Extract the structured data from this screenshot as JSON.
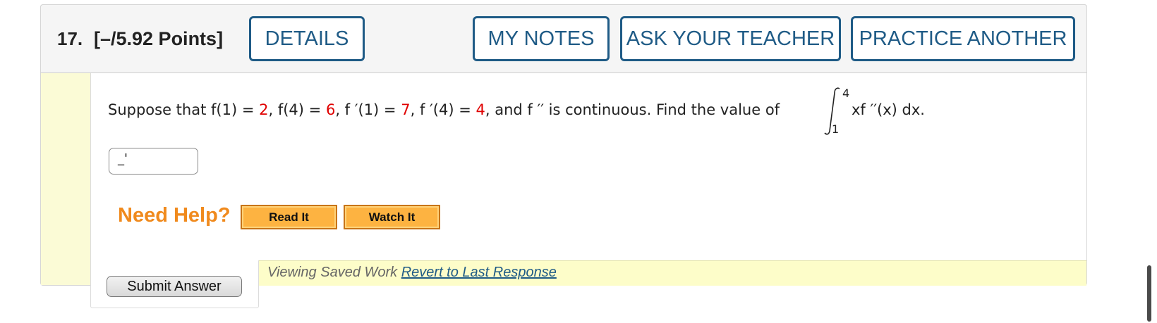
{
  "header": {
    "question_number": "17.",
    "points": "[–/5.92 Points]",
    "details_label": "DETAILS",
    "my_notes_label": "MY NOTES",
    "ask_teacher_label": "ASK YOUR TEACHER",
    "practice_another_label": "PRACTICE ANOTHER"
  },
  "question": {
    "intro": "Suppose that ",
    "f1_lhs": "f(1) = ",
    "f1_val": "2",
    "f4_lhs": "f(4) = ",
    "f4_val": "6",
    "fp1_lhs": "f ′(1) = ",
    "fp1_val": "7",
    "fp4_lhs": "f ′(4) = ",
    "fp4_val": "4",
    "continuity_text": ", and f ′′ is continuous. Find the value of",
    "integral_upper": "4",
    "integral_lower": "1",
    "integrand": "xf ′′(x) dx."
  },
  "answer": {
    "value": "_'"
  },
  "help": {
    "need_help_label": "Need Help?",
    "read_it_label": "Read It",
    "watch_it_label": "Watch It"
  },
  "status": {
    "viewing_text": "Viewing Saved Work ",
    "revert_link": "Revert to Last Response"
  },
  "submit": {
    "label": "Submit Answer"
  },
  "colors": {
    "accent_blue": "#1f5b86",
    "value_red": "#e00000",
    "help_orange": "#f08a1d",
    "status_yellow": "#fdfdc9"
  }
}
